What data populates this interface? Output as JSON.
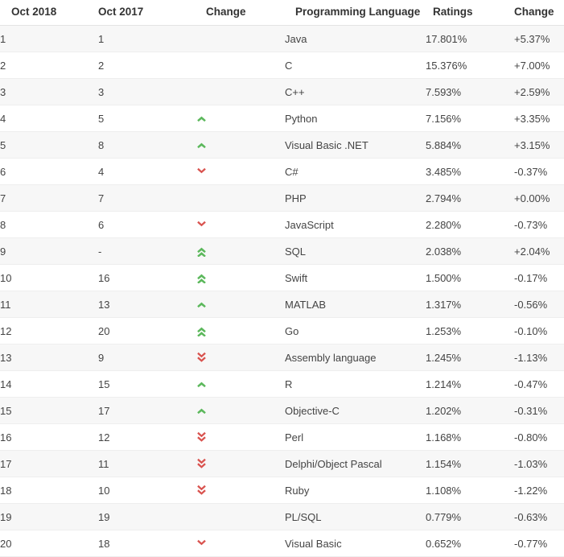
{
  "table": {
    "headers": {
      "rank_new": "Oct 2018",
      "rank_old": "Oct 2017",
      "change": "Change",
      "language": "Programming Language",
      "ratings": "Ratings",
      "delta": "Change"
    },
    "colors": {
      "up": "#5cb85c",
      "down": "#d9534f",
      "text": "#444444",
      "header_text": "#333333",
      "row_odd_bg": "#f7f7f7",
      "row_even_bg": "#ffffff",
      "row_border": "#eeeeee",
      "header_border": "#e4e4e4"
    },
    "icons": {
      "up_single": "chevron-up-icon",
      "up_double": "chevron-double-up-icon",
      "down_single": "chevron-down-icon",
      "down_double": "chevron-double-down-icon",
      "none": "no-change-icon"
    },
    "rows": [
      {
        "rank_new": "1",
        "rank_old": "1",
        "change": "none",
        "language": "Java",
        "ratings": "17.801%",
        "delta": "+5.37%"
      },
      {
        "rank_new": "2",
        "rank_old": "2",
        "change": "none",
        "language": "C",
        "ratings": "15.376%",
        "delta": "+7.00%"
      },
      {
        "rank_new": "3",
        "rank_old": "3",
        "change": "none",
        "language": "C++",
        "ratings": "7.593%",
        "delta": "+2.59%"
      },
      {
        "rank_new": "4",
        "rank_old": "5",
        "change": "up_single",
        "language": "Python",
        "ratings": "7.156%",
        "delta": "+3.35%"
      },
      {
        "rank_new": "5",
        "rank_old": "8",
        "change": "up_single",
        "language": "Visual Basic .NET",
        "ratings": "5.884%",
        "delta": "+3.15%"
      },
      {
        "rank_new": "6",
        "rank_old": "4",
        "change": "down_single",
        "language": "C#",
        "ratings": "3.485%",
        "delta": "-0.37%"
      },
      {
        "rank_new": "7",
        "rank_old": "7",
        "change": "none",
        "language": "PHP",
        "ratings": "2.794%",
        "delta": "+0.00%"
      },
      {
        "rank_new": "8",
        "rank_old": "6",
        "change": "down_single",
        "language": "JavaScript",
        "ratings": "2.280%",
        "delta": "-0.73%"
      },
      {
        "rank_new": "9",
        "rank_old": "-",
        "change": "up_double",
        "language": "SQL",
        "ratings": "2.038%",
        "delta": "+2.04%"
      },
      {
        "rank_new": "10",
        "rank_old": "16",
        "change": "up_double",
        "language": "Swift",
        "ratings": "1.500%",
        "delta": "-0.17%"
      },
      {
        "rank_new": "11",
        "rank_old": "13",
        "change": "up_single",
        "language": "MATLAB",
        "ratings": "1.317%",
        "delta": "-0.56%"
      },
      {
        "rank_new": "12",
        "rank_old": "20",
        "change": "up_double",
        "language": "Go",
        "ratings": "1.253%",
        "delta": "-0.10%"
      },
      {
        "rank_new": "13",
        "rank_old": "9",
        "change": "down_double",
        "language": "Assembly language",
        "ratings": "1.245%",
        "delta": "-1.13%"
      },
      {
        "rank_new": "14",
        "rank_old": "15",
        "change": "up_single",
        "language": "R",
        "ratings": "1.214%",
        "delta": "-0.47%"
      },
      {
        "rank_new": "15",
        "rank_old": "17",
        "change": "up_single",
        "language": "Objective-C",
        "ratings": "1.202%",
        "delta": "-0.31%"
      },
      {
        "rank_new": "16",
        "rank_old": "12",
        "change": "down_double",
        "language": "Perl",
        "ratings": "1.168%",
        "delta": "-0.80%"
      },
      {
        "rank_new": "17",
        "rank_old": "11",
        "change": "down_double",
        "language": "Delphi/Object Pascal",
        "ratings": "1.154%",
        "delta": "-1.03%"
      },
      {
        "rank_new": "18",
        "rank_old": "10",
        "change": "down_double",
        "language": "Ruby",
        "ratings": "1.108%",
        "delta": "-1.22%"
      },
      {
        "rank_new": "19",
        "rank_old": "19",
        "change": "none",
        "language": "PL/SQL",
        "ratings": "0.779%",
        "delta": "-0.63%"
      },
      {
        "rank_new": "20",
        "rank_old": "18",
        "change": "down_single",
        "language": "Visual Basic",
        "ratings": "0.652%",
        "delta": "-0.77%"
      }
    ]
  }
}
